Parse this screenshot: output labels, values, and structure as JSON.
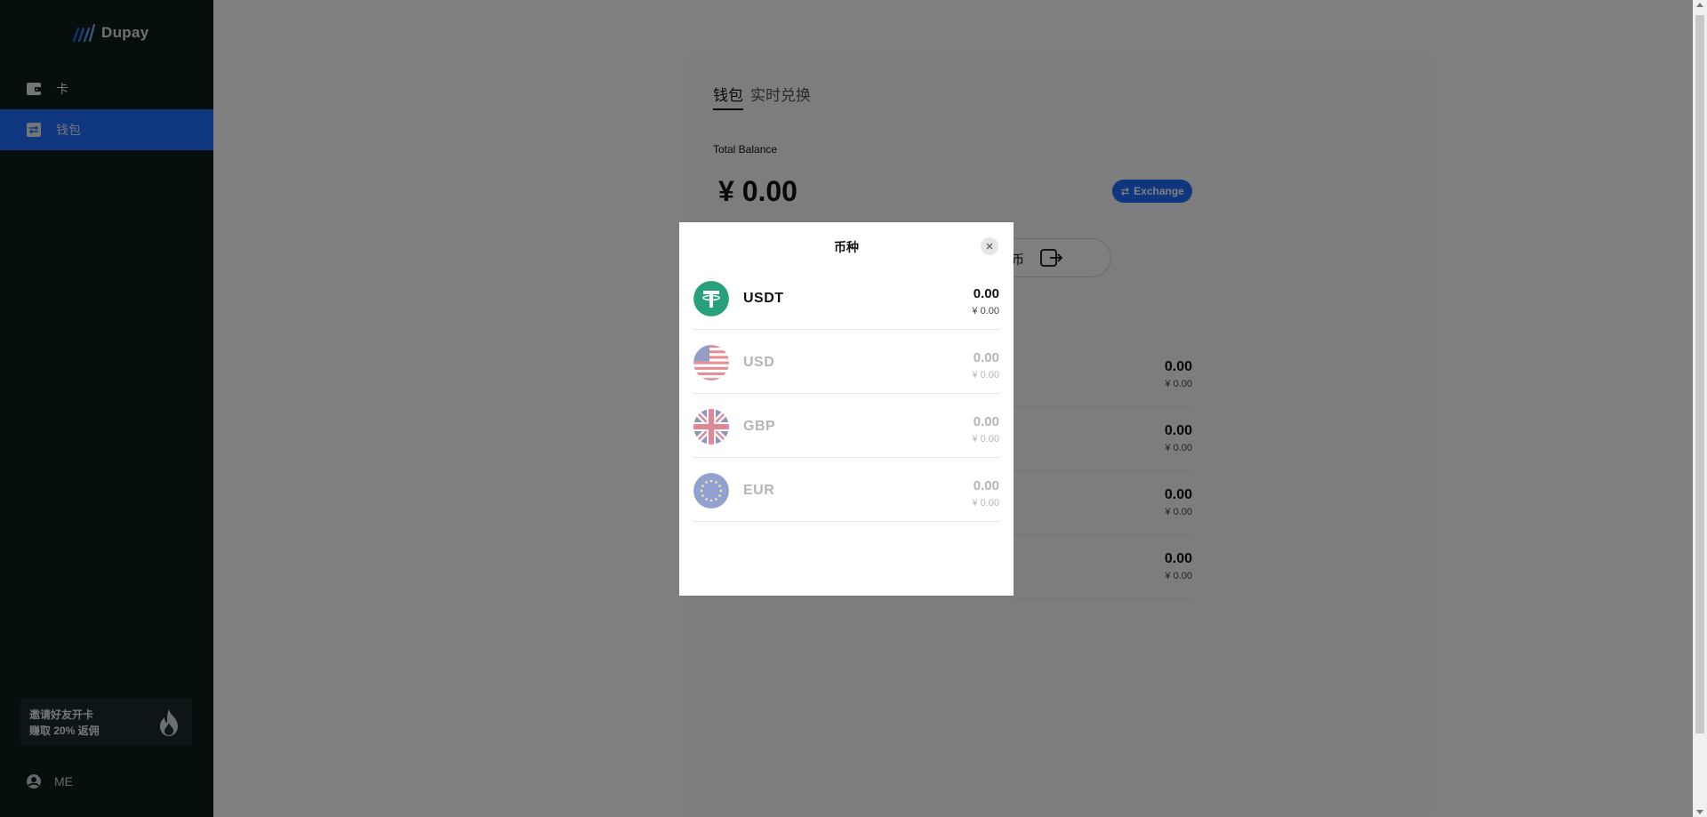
{
  "app": {
    "logo_text": "Dupay"
  },
  "sidebar": {
    "items": [
      {
        "label": "卡",
        "icon": "wallet-icon"
      },
      {
        "label": "钱包",
        "icon": "exchange-arrows-icon"
      }
    ],
    "promo": {
      "line1": "邀请好友开卡",
      "line2": "赚取 20% 返佣",
      "icon": "flame-icon"
    },
    "me_label": "ME"
  },
  "wallet": {
    "tabs": [
      "钱包",
      "实时兑换"
    ],
    "total_label": "Total Balance",
    "total_value": "¥ 0.00",
    "exchange_label": "Exchange",
    "pill_text": "币",
    "rows": [
      {
        "amount": "0.00",
        "cny": "¥  0.00"
      },
      {
        "amount": "0.00",
        "cny": "¥  0.00"
      },
      {
        "amount": "0.00",
        "cny": "¥  0.00"
      },
      {
        "amount": "0.00",
        "cny": "¥  0.00"
      }
    ]
  },
  "modal": {
    "title": "币种",
    "currencies": [
      {
        "code": "USDT",
        "amount": "0.00",
        "cny": "¥  0.00",
        "icon": "tether-icon",
        "enabled": true
      },
      {
        "code": "USD",
        "amount": "0.00",
        "cny": "¥  0.00",
        "icon": "us-flag-icon",
        "enabled": false
      },
      {
        "code": "GBP",
        "amount": "0.00",
        "cny": "¥  0.00",
        "icon": "uk-flag-icon",
        "enabled": false
      },
      {
        "code": "EUR",
        "amount": "0.00",
        "cny": "¥  0.00",
        "icon": "eu-flag-icon",
        "enabled": false
      }
    ]
  },
  "colors": {
    "sidebar_bg": "#0f1e1a",
    "accent": "#1f6fff",
    "tether": "#26a17b"
  }
}
